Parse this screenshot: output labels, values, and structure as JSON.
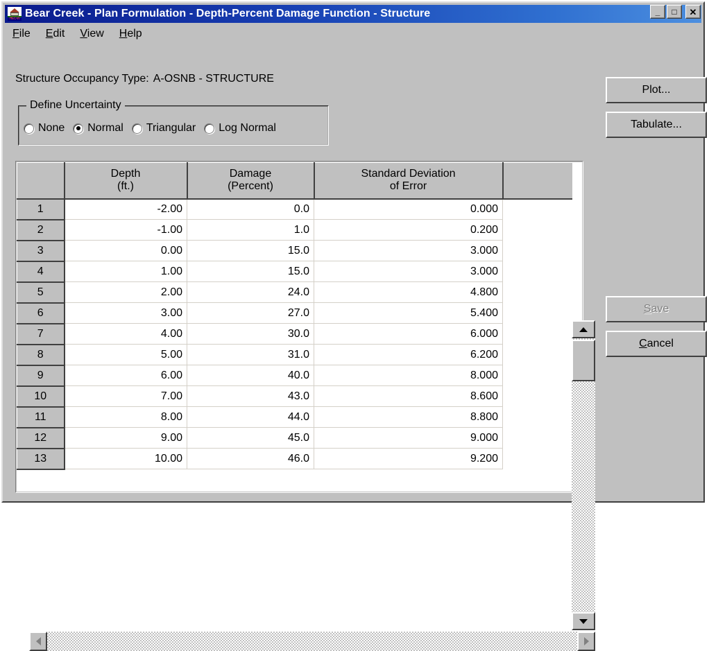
{
  "window": {
    "title": "Bear Creek - Plan Formulation - Depth-Percent Damage Function - Structure",
    "icon": "hec-house-icon",
    "icon_caption": "HEC-W",
    "controls": {
      "minimize": "_",
      "maximize": "□",
      "close": "✕"
    }
  },
  "menubar": {
    "items": [
      {
        "label": "File",
        "mnemonic": "F"
      },
      {
        "label": "Edit",
        "mnemonic": "E"
      },
      {
        "label": "View",
        "mnemonic": "V"
      },
      {
        "label": "Help",
        "mnemonic": "H"
      }
    ]
  },
  "occupancy": {
    "label": "Structure Occupancy Type:",
    "value": "A-OSNB - STRUCTURE"
  },
  "uncertainty": {
    "legend": "Define Uncertainty",
    "selected": "Normal",
    "options": [
      {
        "label": "None",
        "checked": false
      },
      {
        "label": "Normal",
        "checked": true
      },
      {
        "label": "Triangular",
        "checked": false
      },
      {
        "label": "Log Normal",
        "checked": false
      }
    ]
  },
  "grid": {
    "columns": [
      {
        "line1": "",
        "line2": ""
      },
      {
        "line1": "Depth",
        "line2": "(ft.)"
      },
      {
        "line1": "Damage",
        "line2": "(Percent)"
      },
      {
        "line1": "Standard Deviation",
        "line2": "of Error"
      },
      {
        "line1": "",
        "line2": ""
      }
    ],
    "rows": [
      {
        "num": "1",
        "depth": "-2.00",
        "damage": "0.0",
        "sd": "0.000"
      },
      {
        "num": "2",
        "depth": "-1.00",
        "damage": "1.0",
        "sd": "0.200"
      },
      {
        "num": "3",
        "depth": "0.00",
        "damage": "15.0",
        "sd": "3.000"
      },
      {
        "num": "4",
        "depth": "1.00",
        "damage": "15.0",
        "sd": "3.000"
      },
      {
        "num": "5",
        "depth": "2.00",
        "damage": "24.0",
        "sd": "4.800"
      },
      {
        "num": "6",
        "depth": "3.00",
        "damage": "27.0",
        "sd": "5.400"
      },
      {
        "num": "7",
        "depth": "4.00",
        "damage": "30.0",
        "sd": "6.000"
      },
      {
        "num": "8",
        "depth": "5.00",
        "damage": "31.0",
        "sd": "6.200"
      },
      {
        "num": "9",
        "depth": "6.00",
        "damage": "40.0",
        "sd": "8.000"
      },
      {
        "num": "10",
        "depth": "7.00",
        "damage": "43.0",
        "sd": "8.600"
      },
      {
        "num": "11",
        "depth": "8.00",
        "damage": "44.0",
        "sd": "8.800"
      },
      {
        "num": "12",
        "depth": "9.00",
        "damage": "45.0",
        "sd": "9.000"
      },
      {
        "num": "13",
        "depth": "10.00",
        "damage": "46.0",
        "sd": "9.200"
      }
    ]
  },
  "buttons": {
    "plot": "Plot...",
    "tabulate": "Tabulate...",
    "save": "Save",
    "save_mnemonic": "S",
    "save_enabled": false,
    "cancel": "Cancel",
    "cancel_mnemonic": "C"
  },
  "scrollbars": {
    "vertical": {
      "up": "scroll-up-arrow",
      "down": "scroll-down-arrow",
      "thumb_position": "top"
    },
    "horizontal": {
      "left": "scroll-left-arrow",
      "right": "scroll-right-arrow",
      "thumb_position": "none"
    }
  },
  "colors": {
    "face": "#c0c0c0",
    "title_start": "#0a1a8c",
    "title_end": "#4c8fe0",
    "text": "#000000",
    "disabled_text": "#808080",
    "grid_background": "#ffffff"
  }
}
